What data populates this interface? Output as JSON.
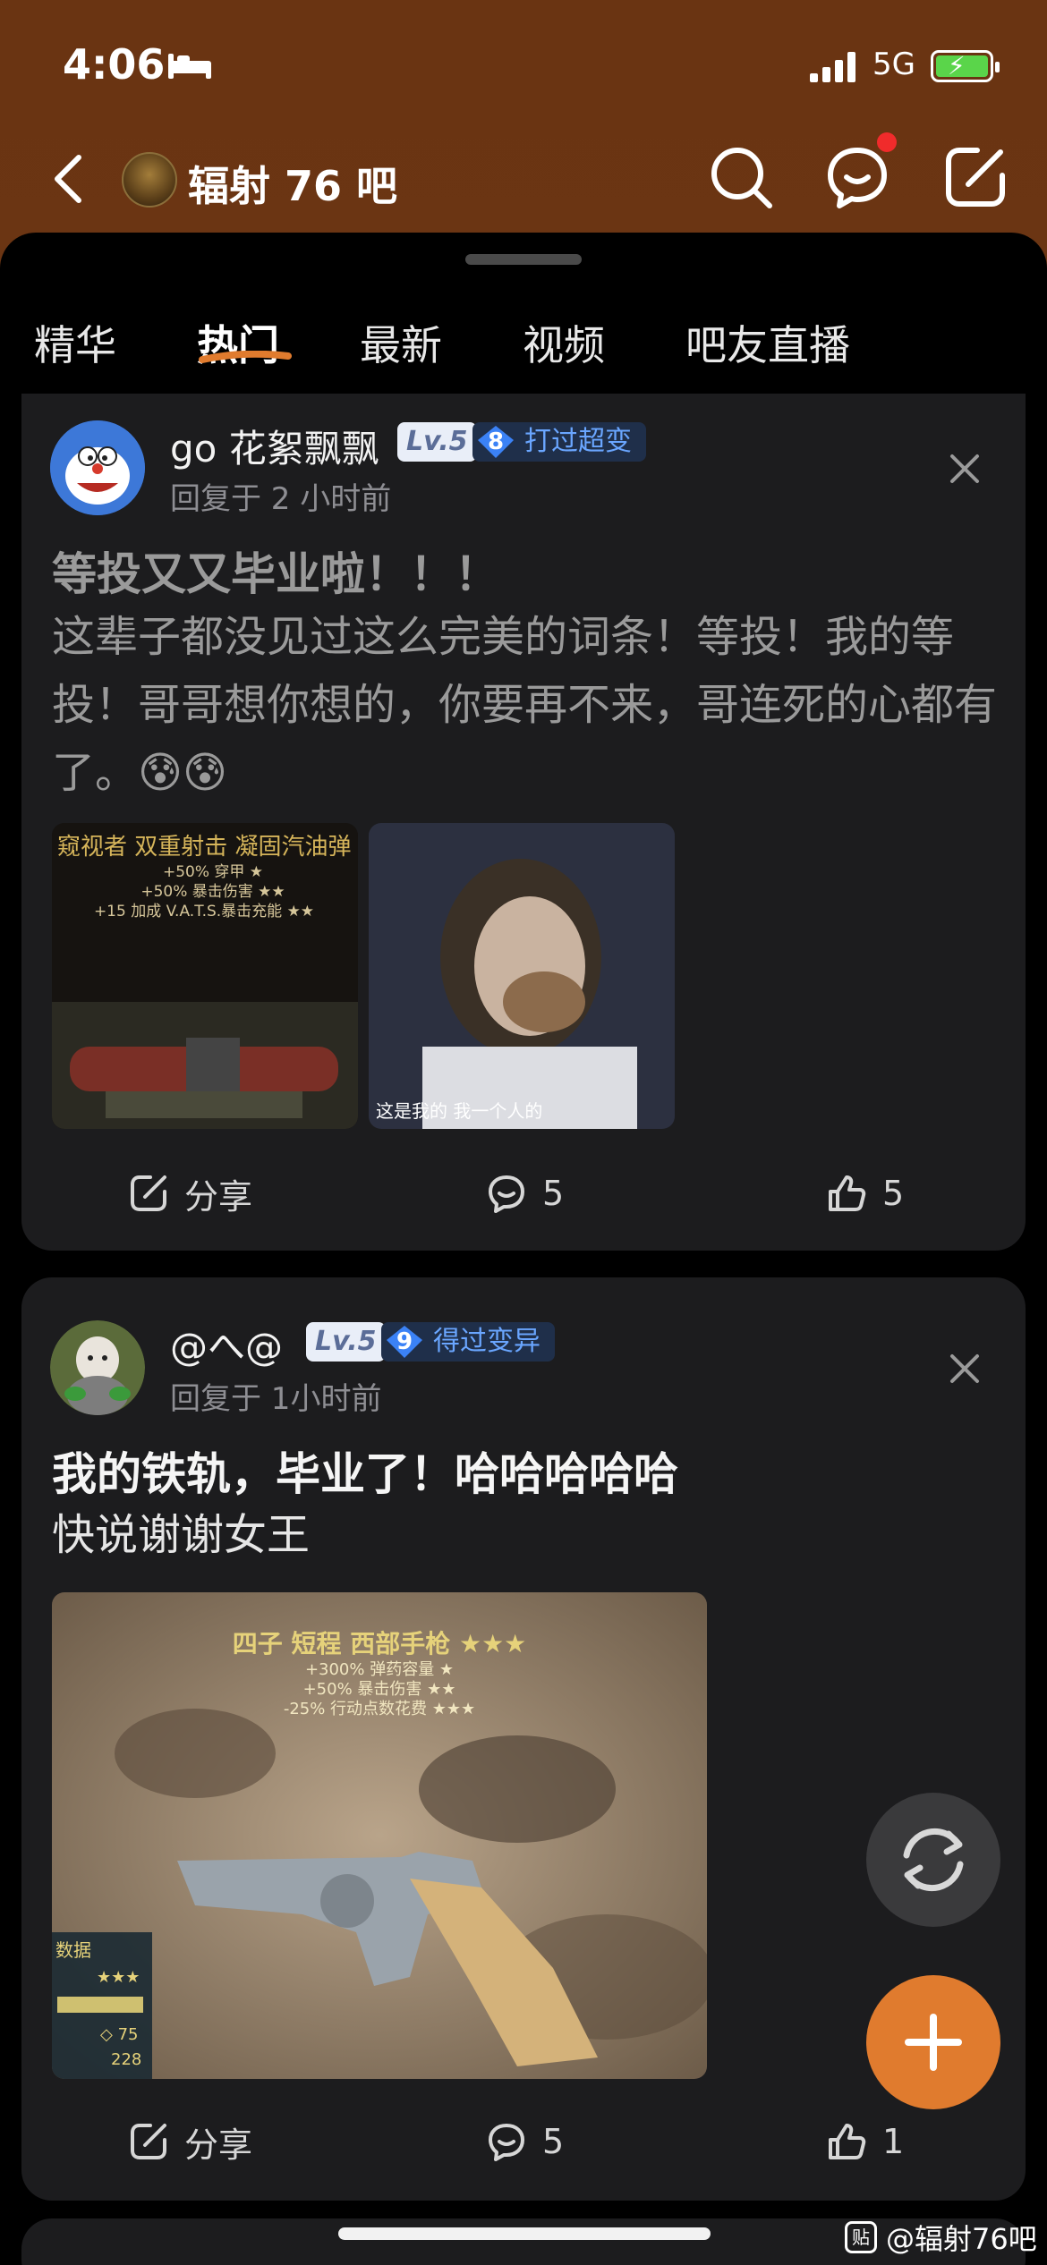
{
  "status": {
    "time": "4:06",
    "network": "5G"
  },
  "header": {
    "forum_title": "辐射 76 吧"
  },
  "tabs": [
    "精华",
    "热门",
    "最新",
    "视频",
    "吧友直播"
  ],
  "active_tab": "热门",
  "posts": [
    {
      "user": "go 花絮飘飘",
      "level": "Lv.5",
      "honor_num": "8",
      "honor": "打过超变",
      "reply_time": "回复于 2 小时前",
      "title": "等投又又毕业啦！！！",
      "body": "这辈子都没见过这么完美的词条！等投！我的等投！哥哥想你想的，你要再不来，哥连死的心都有了。😰😰",
      "images": [
        {
          "caption_title": "窥视者 双重射击 凝固汽油弹",
          "lines": [
            "+50% 穿甲 ★",
            "+50% 暴击伤害 ★★",
            "+15 加成 V.A.T.S.暴击充能 ★★"
          ]
        },
        {
          "subtitle": "这是我的 我一个人的"
        }
      ],
      "share": "分享",
      "comments": "5",
      "likes": "5"
    },
    {
      "user": "@へ@",
      "level": "Lv.5",
      "honor_num": "9",
      "honor": "得过变异",
      "reply_time": "回复于 1小时前",
      "title": "我的铁轨，毕业了！哈哈哈哈哈",
      "body": "快说谢谢女王",
      "images": [
        {
          "caption_title": "四子 短程 西部手枪 ★★★",
          "lines": [
            "+300% 弹药容量 ★",
            "+50% 暴击伤害 ★★",
            "-25% 行动点数花费 ★★★"
          ],
          "side_label": "数据",
          "side_stars": "★★★",
          "side_val1": "◇ 75",
          "side_val2": "228"
        }
      ],
      "share": "分享",
      "comments": "5",
      "likes": "1"
    }
  ],
  "watermark": "@辐射76吧",
  "watermark_box": "贴",
  "colors": {
    "header_bg": "#6b3513",
    "accent": "#e07b2e",
    "card_bg": "#1c1c1e",
    "honor_text": "#6aa6ff"
  }
}
